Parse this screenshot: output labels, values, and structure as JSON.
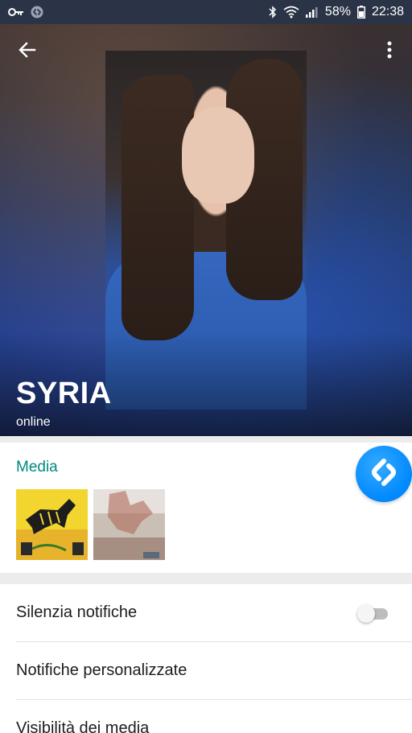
{
  "status_bar": {
    "left_icons": [
      "key-icon",
      "shazam-notification-icon"
    ],
    "right_icons": [
      "bluetooth-icon",
      "wifi-icon",
      "signal-icon",
      "battery-icon"
    ],
    "battery_percent": "58%",
    "time": "22:38"
  },
  "header": {
    "contact_name": "SYRIA",
    "status": "online",
    "back_icon": "arrow-left-icon",
    "menu_icon": "more-vert-icon"
  },
  "media": {
    "title": "Media",
    "thumbnails": [
      "zebra-mural-thumbnail",
      "stone-relief-thumbnail"
    ]
  },
  "settings": [
    {
      "label": "Silenzia notifiche",
      "has_toggle": true,
      "toggle_on": false
    },
    {
      "label": "Notifiche personalizzate",
      "has_toggle": false
    },
    {
      "label": "Visibilità dei media",
      "has_toggle": false
    }
  ],
  "colors": {
    "status_bar": "#2b3447",
    "accent": "#00897b",
    "shazam_blue": "#0088ff"
  }
}
